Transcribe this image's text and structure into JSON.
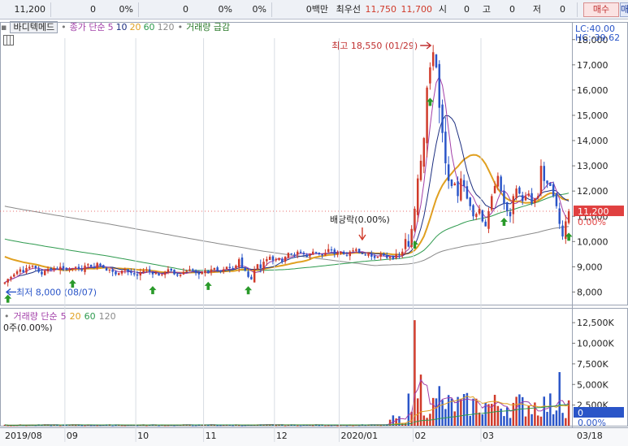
{
  "quote_bar": {
    "cells": [
      "11,200",
      "0",
      "0%",
      "0",
      "0%",
      "0%",
      "0백만",
      "최우선",
      "11,750",
      "11,700",
      "시",
      "0",
      "고",
      "0",
      "저",
      "0"
    ],
    "buy_label": "매수",
    "sell_label": "매"
  },
  "toolbar": {
    "style_button": "바디텍메드",
    "price_label": "종가 단순",
    "ma_periods": [
      "5",
      "10",
      "20",
      "60",
      "120"
    ],
    "volume_label": "거래량 급감"
  },
  "volume_toolbar": {
    "label": "거래량 단순",
    "ma_periods": [
      "5",
      "20",
      "60",
      "120"
    ],
    "zero_label": "0주(0.00%)"
  },
  "colors": {
    "up": "#d03a2a",
    "down": "#2a55c8",
    "ma5": "#a23fa8",
    "ma10": "#1c2e80",
    "ma20": "#e0a020",
    "ma60": "#2e9a4e",
    "ma120": "#8a8a8a",
    "signal": "#2a9a2a",
    "price_tag": "#e04040"
  },
  "chart_data": [
    {
      "type": "candlestick",
      "title": "",
      "x_tick_labels": [
        "2019/08",
        "09",
        "10",
        "11",
        "12",
        "2020/01",
        "02",
        "03",
        "03/18"
      ],
      "y_tick_labels": [
        "8,000",
        "9,000",
        "10,000",
        "11,000",
        "12,000",
        "13,000",
        "14,000",
        "15,000",
        "16,000",
        "17,000",
        "18,000"
      ],
      "ylim": [
        7500,
        18700
      ],
      "corner_labels": [
        "LC:40.00",
        "HC:-39.62"
      ],
      "current_price": "11,200",
      "current_change": "0.00%",
      "current_value": 11200,
      "annotations": {
        "high": "최고 18,550 (01/29)",
        "low": "최저 8,000 (08/07)",
        "dividend": "배당락(0.00%)"
      },
      "series_names": [
        "5",
        "10",
        "20",
        "60",
        "120"
      ],
      "close": [
        8380,
        8520,
        8600,
        8700,
        8820,
        8900,
        8780,
        8950,
        9000,
        9050,
        8950,
        8800,
        8700,
        8850,
        8920,
        8880,
        8950,
        8900,
        9000,
        8950,
        8880,
        8900,
        8950,
        9000,
        8920,
        8850,
        9050,
        9100,
        9000,
        8950,
        9150,
        9050,
        8950,
        8850,
        8900,
        8800,
        8700,
        8750,
        8850,
        8900,
        8800,
        8750,
        8700,
        8650,
        8780,
        8850,
        8900,
        8800,
        8700,
        8750,
        8650,
        8700,
        8800,
        8900,
        8850,
        8700,
        8650,
        8700,
        8800,
        8850,
        8900,
        8850,
        8750,
        8700,
        8800,
        8850,
        8750,
        8900,
        8950,
        8850,
        8800,
        8900,
        9000,
        8950,
        8900,
        9050,
        9300,
        8950,
        8850,
        8600,
        8500,
        8900,
        9100,
        8950,
        9200,
        9300,
        9400,
        9250,
        9300,
        9350,
        9200,
        9400,
        9550,
        9500,
        9450,
        9600,
        9550,
        9500,
        9400,
        9500,
        9600,
        9550,
        9500,
        9450,
        9550,
        9700,
        9650,
        9500,
        9550,
        9600,
        9500,
        9450,
        9600,
        9650,
        9700,
        9550,
        9500,
        9450,
        9550,
        9400,
        9350,
        9400,
        9500,
        9450,
        9350,
        9400,
        9300,
        9500,
        9450,
        9600,
        10100,
        9800,
        10500,
        11300,
        12500,
        13200,
        14100,
        16100,
        16900,
        17500,
        16900,
        15300,
        14300,
        13100,
        12400,
        12200,
        12300,
        11800,
        12500,
        12200,
        11700,
        11400,
        11000,
        11100,
        11300,
        10800,
        10600,
        11200,
        11800,
        12200,
        12600,
        12000,
        11500,
        11200,
        11000,
        11800,
        12100,
        11900,
        11600,
        11800,
        11900,
        11500,
        11700,
        11800,
        13000,
        12400,
        12300,
        12200,
        11800,
        11400,
        10700,
        10200,
        10800,
        11200
      ]
    },
    {
      "type": "bar",
      "title": "",
      "y_tick_labels": [
        "2,500K",
        "5,000K",
        "7,500K",
        "10,000K",
        "12,500K"
      ],
      "ylim": [
        0,
        13500000
      ],
      "current_volume_label": "0",
      "current_volume_pct": "0.00%",
      "series_names": [
        "5",
        "20",
        "60",
        "120"
      ]
    }
  ]
}
